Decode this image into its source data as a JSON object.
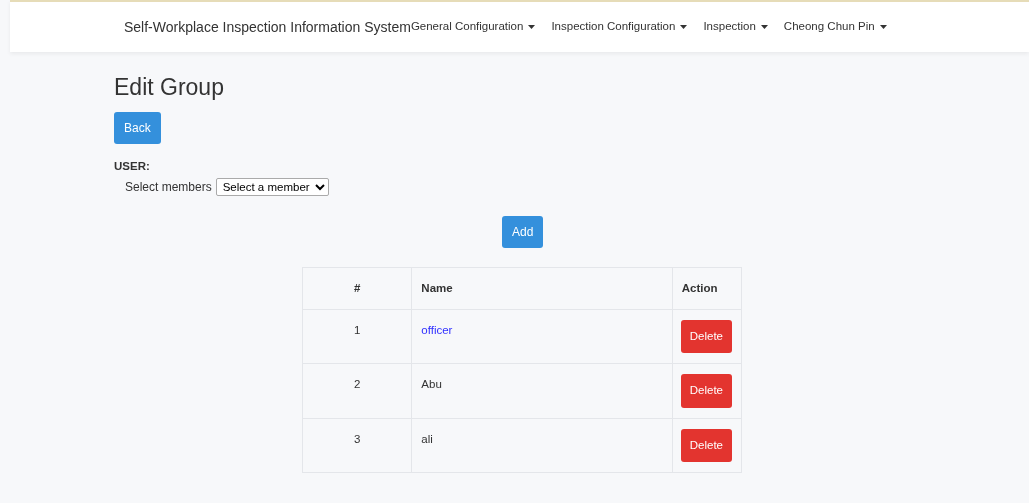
{
  "navbar": {
    "brand": "Self-Workplace Inspection Information System",
    "menus": [
      {
        "label": "General Configuration"
      },
      {
        "label": "Inspection Configuration"
      },
      {
        "label": "Inspection"
      },
      {
        "label": "Cheong Chun Pin"
      }
    ]
  },
  "page_title": "Edit Group",
  "back_button": "Back",
  "user_label": "USER:",
  "select_label": "Select members",
  "select_value": "Select a member",
  "add_button": "Add",
  "table": {
    "columns": [
      "#",
      "Name",
      "Action"
    ],
    "rows": [
      {
        "number": "1",
        "name": "officer",
        "kind": "link",
        "action": "Delete"
      },
      {
        "number": "2",
        "name": "Abu",
        "kind": "text",
        "action": "Delete"
      },
      {
        "number": "3",
        "name": "ali",
        "kind": "text",
        "action": "Delete"
      }
    ]
  }
}
